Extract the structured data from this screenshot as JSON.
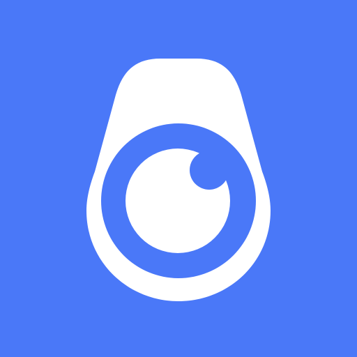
{
  "icon": {
    "name": "camera-lens-icon",
    "colors": {
      "background": "#4a78f8",
      "body": "#ffffff",
      "lens_ring": "#4a78f8",
      "lens_inner": "#ffffff",
      "highlight": "#4a78f8"
    }
  }
}
